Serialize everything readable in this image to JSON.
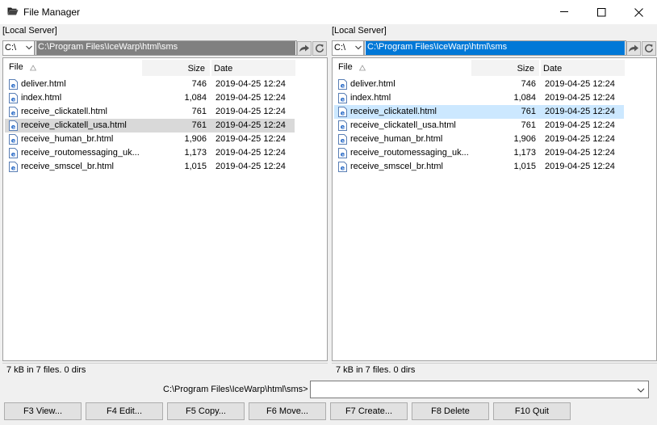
{
  "window": {
    "title": "File Manager"
  },
  "icons": {
    "app": "folder-icon",
    "file": "html-file-icon",
    "minimize": "minimize-icon",
    "maximize": "maximize-icon",
    "close": "close-icon",
    "go": "go-arrow-icon",
    "refresh": "refresh-icon",
    "dropdown": "chevron-down-icon",
    "sort": "sort-ascending-icon"
  },
  "colors": {
    "active_path": "#0078d7",
    "inactive_path": "#808080",
    "selected_row_active": "#cce8ff",
    "selected_row_inactive": "#d9d9d9"
  },
  "columns": {
    "file": "File",
    "size": "Size",
    "date": "Date"
  },
  "left_panel": {
    "label": "[Local Server]",
    "drive": "C:\\",
    "path": "C:\\Program Files\\IceWarp\\html\\sms",
    "status": "7 kB in 7 files. 0 dirs",
    "selected_index": 3,
    "files": [
      {
        "name": "deliver.html",
        "size": "746",
        "date": "2019-04-25 12:24"
      },
      {
        "name": "index.html",
        "size": "1,084",
        "date": "2019-04-25 12:24"
      },
      {
        "name": "receive_clickatell.html",
        "size": "761",
        "date": "2019-04-25 12:24"
      },
      {
        "name": "receive_clickatell_usa.html",
        "size": "761",
        "date": "2019-04-25 12:24"
      },
      {
        "name": "receive_human_br.html",
        "size": "1,906",
        "date": "2019-04-25 12:24"
      },
      {
        "name": "receive_routomessaging_uk...",
        "size": "1,173",
        "date": "2019-04-25 12:24"
      },
      {
        "name": "receive_smscel_br.html",
        "size": "1,015",
        "date": "2019-04-25 12:24"
      }
    ]
  },
  "right_panel": {
    "label": "[Local Server]",
    "drive": "C:\\",
    "path": "C:\\Program Files\\IceWarp\\html\\sms",
    "status": "7 kB in 7 files. 0 dirs",
    "selected_index": 2,
    "files": [
      {
        "name": "deliver.html",
        "size": "746",
        "date": "2019-04-25 12:24"
      },
      {
        "name": "index.html",
        "size": "1,084",
        "date": "2019-04-25 12:24"
      },
      {
        "name": "receive_clickatell.html",
        "size": "761",
        "date": "2019-04-25 12:24"
      },
      {
        "name": "receive_clickatell_usa.html",
        "size": "761",
        "date": "2019-04-25 12:24"
      },
      {
        "name": "receive_human_br.html",
        "size": "1,906",
        "date": "2019-04-25 12:24"
      },
      {
        "name": "receive_routomessaging_uk...",
        "size": "1,173",
        "date": "2019-04-25 12:24"
      },
      {
        "name": "receive_smscel_br.html",
        "size": "1,015",
        "date": "2019-04-25 12:24"
      }
    ]
  },
  "command": {
    "label": "C:\\Program Files\\IceWarp\\html\\sms>",
    "value": ""
  },
  "buttons": [
    {
      "id": "view",
      "label": "F3 View..."
    },
    {
      "id": "edit",
      "label": "F4 Edit..."
    },
    {
      "id": "copy",
      "label": "F5 Copy..."
    },
    {
      "id": "move",
      "label": "F6 Move..."
    },
    {
      "id": "create",
      "label": "F7 Create..."
    },
    {
      "id": "delete",
      "label": "F8 Delete"
    },
    {
      "id": "quit",
      "label": "F10 Quit"
    }
  ]
}
